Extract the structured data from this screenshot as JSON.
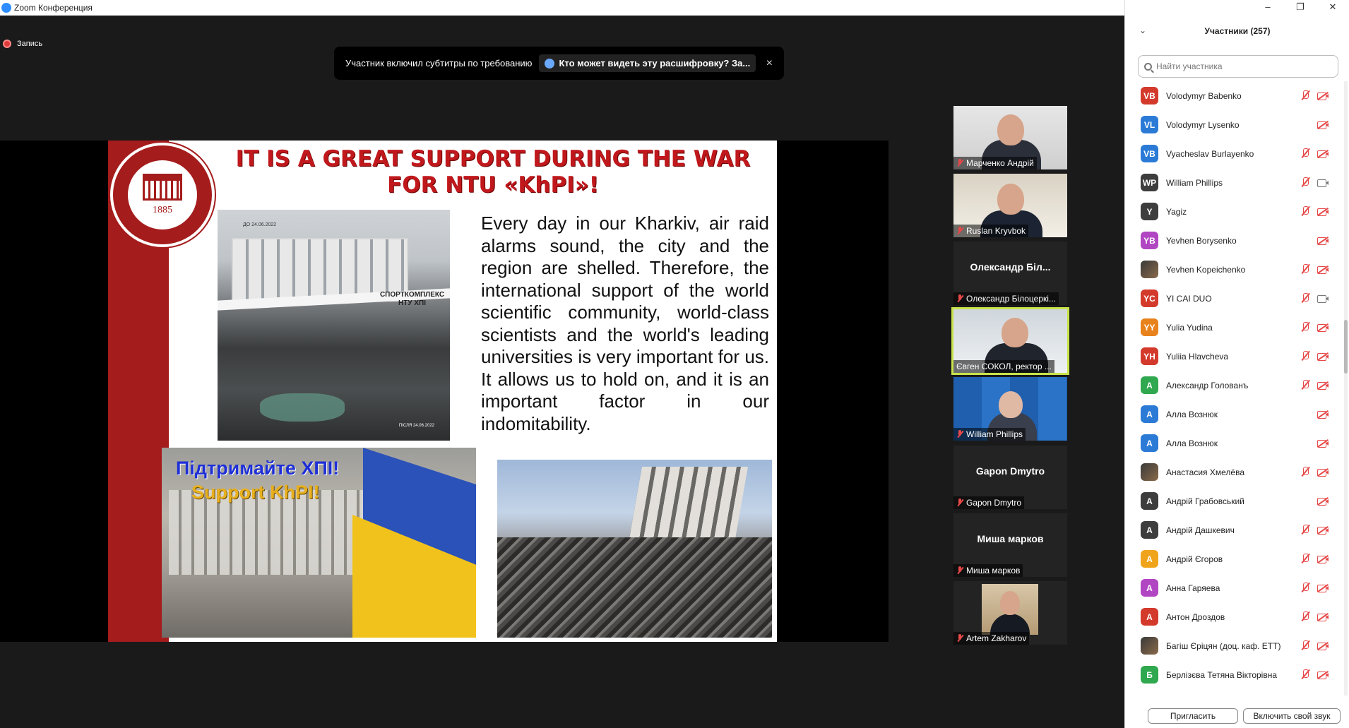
{
  "window": {
    "title": "Zoom Конференция"
  },
  "recording": {
    "label": "Запись"
  },
  "notice": {
    "message": "Участник включил субтитры по требованию",
    "link": "Кто может видеть эту расшифровку? За...",
    "close": "×"
  },
  "slide": {
    "headline_line1": "IT IS A GREAT SUPPORT DURING THE WAR",
    "headline_line2": "FOR NTU «KhPI»!",
    "body": "Every day in our Kharkiv, air raid alarms sound, the city and the region are shelled. Therefore, the international support of the world scientific community, world-class scientists and the world's leading universities is very important for us. It allows us to hold on, and it is an important factor in our indomitability.",
    "logo_year": "1885",
    "photo1_caption_top": "ДО 24.06.2022",
    "photo1_sign": "СПОРТКОМПЛЕКС НТУ ХПІ",
    "photo1_caption_bottom": "ПІСЛЯ 24.06.2022",
    "photo2_title_ua": "Підтримайте ХПІ!",
    "photo2_title_en": "Support KhPI!"
  },
  "thumbnails": [
    {
      "name": "Марченко Андрій",
      "has_video": true
    },
    {
      "name": "Ruslan Kryvbok",
      "has_video": true
    },
    {
      "name": "Олександр Білоцеркі...",
      "big_name": "Олександр Біл...",
      "has_video": false
    },
    {
      "name": "Євген СОКОЛ, ректор ...",
      "has_video": true,
      "active": true
    },
    {
      "name": "William Phillips",
      "has_video": true
    },
    {
      "name": "Gapon Dmytro",
      "big_name": "Gapon Dmytro",
      "has_video": false
    },
    {
      "name": "Миша марков",
      "big_name": "Миша марков",
      "has_video": false
    },
    {
      "name": "Artem Zakharov",
      "has_video": true
    }
  ],
  "panel": {
    "title": "Участники (257)",
    "search_placeholder": "Найти участника",
    "invite_label": "Пригласить",
    "unmute_label": "Включить свой звук",
    "window_controls": [
      "–",
      "❐",
      "✕"
    ],
    "participants": [
      {
        "initials": "VB",
        "name": "Volodymyr Babenko",
        "color": "#d33a2c",
        "mic": "off",
        "cam": "off"
      },
      {
        "initials": "VL",
        "name": "Volodymyr Lysenko",
        "color": "#2b7bd6",
        "mic": "none",
        "cam": "off"
      },
      {
        "initials": "VB",
        "name": "Vyacheslav Burlayenko",
        "color": "#2b7bd6",
        "mic": "off",
        "cam": "off"
      },
      {
        "initials": "WP",
        "name": "William Phillips",
        "color": "#3d3d3d",
        "mic": "off",
        "cam": "on"
      },
      {
        "initials": "Y",
        "name": "Yagiz",
        "color": "#3d3d3d",
        "mic": "off",
        "cam": "off"
      },
      {
        "initials": "YB",
        "name": "Yevhen Borysenko",
        "color": "#b146c2",
        "mic": "none",
        "cam": "off"
      },
      {
        "initials": "",
        "name": "Yevhen Kopeichenko",
        "color": "photo",
        "mic": "off",
        "cam": "off"
      },
      {
        "initials": "YC",
        "name": "YI CAI DUO",
        "color": "#d33a2c",
        "mic": "off",
        "cam": "on"
      },
      {
        "initials": "YY",
        "name": "Yulia Yudina",
        "color": "#e8821c",
        "mic": "off",
        "cam": "off"
      },
      {
        "initials": "YH",
        "name": "Yuliia Hlavcheva",
        "color": "#d33a2c",
        "mic": "off",
        "cam": "off"
      },
      {
        "initials": "А",
        "name": "Александр Голованъ",
        "color": "#2fa84f",
        "mic": "off",
        "cam": "off"
      },
      {
        "initials": "А",
        "name": "Алла Вознюк",
        "color": "#2b7bd6",
        "mic": "none",
        "cam": "off"
      },
      {
        "initials": "А",
        "name": "Алла Вознюк",
        "color": "#2b7bd6",
        "mic": "none",
        "cam": "off"
      },
      {
        "initials": "",
        "name": "Анастасия Хмелёва",
        "color": "photo",
        "mic": "off",
        "cam": "off"
      },
      {
        "initials": "А",
        "name": "Андрій Грабовський",
        "color": "#3d3d3d",
        "mic": "none",
        "cam": "off"
      },
      {
        "initials": "А",
        "name": "Андрій Дашкевич",
        "color": "#3d3d3d",
        "mic": "off",
        "cam": "off"
      },
      {
        "initials": "А",
        "name": "Андрій Єгоров",
        "color": "#f0a41c",
        "mic": "off",
        "cam": "off"
      },
      {
        "initials": "А",
        "name": "Анна Гаряева",
        "color": "#b146c2",
        "mic": "off",
        "cam": "off"
      },
      {
        "initials": "А",
        "name": "Антон Дроздов",
        "color": "#d33a2c",
        "mic": "off",
        "cam": "off"
      },
      {
        "initials": "",
        "name": "Багіш Єріцян (доц. каф. ЕТТ)",
        "color": "photo",
        "mic": "off",
        "cam": "off"
      },
      {
        "initials": "Б",
        "name": "Берлізєва Тетяна Вікторівна",
        "color": "#2fa84f",
        "mic": "off",
        "cam": "off"
      }
    ]
  }
}
